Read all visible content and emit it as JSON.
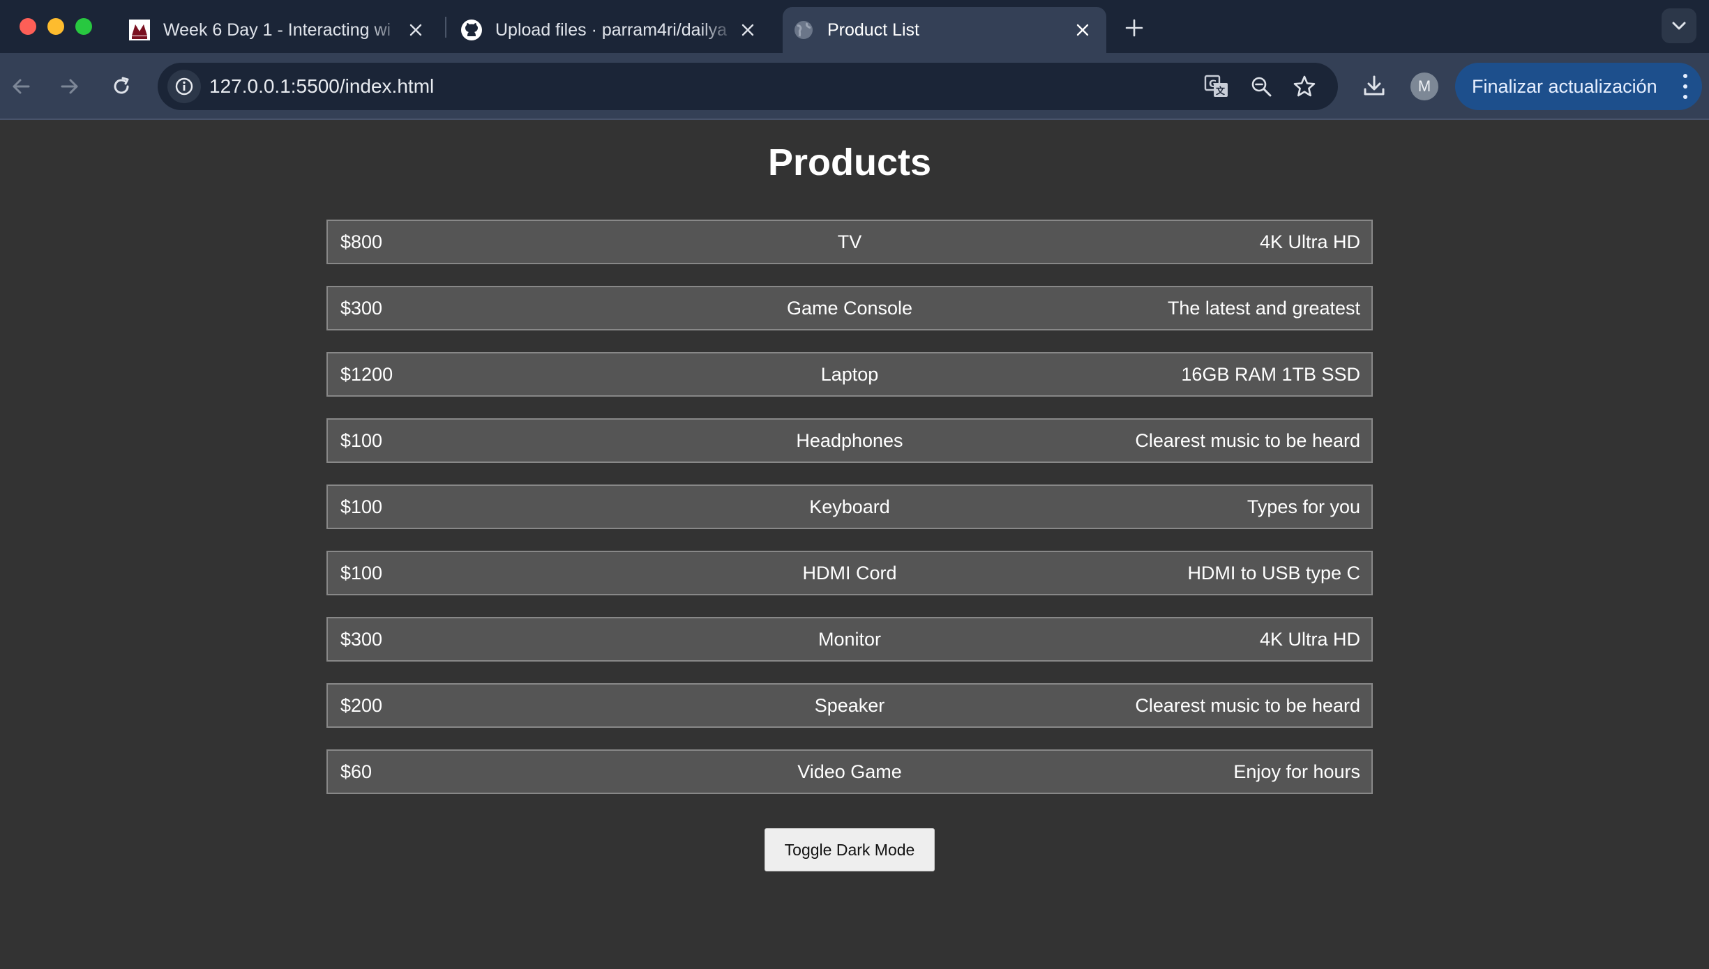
{
  "browser": {
    "tabs": [
      {
        "title": "Week 6 Day 1 - Interacting wi",
        "favicon": "school-logo-icon",
        "active": false
      },
      {
        "title": "Upload files · parram4ri/dailya",
        "favicon": "github-icon",
        "active": false
      },
      {
        "title": "Product List",
        "favicon": "globe-icon",
        "active": true
      }
    ],
    "url": "127.0.0.1:5500/index.html",
    "profile_initial": "M",
    "update_button_label": "Finalizar actualización",
    "colors": {
      "tabstrip": "#1b2537",
      "toolbar": "#344056",
      "update_button": "#1d4f8c"
    }
  },
  "page": {
    "title": "Products",
    "background": "#333333",
    "products": [
      {
        "price": "$800",
        "name": "TV",
        "description": "4K Ultra HD"
      },
      {
        "price": "$300",
        "name": "Game Console",
        "description": "The latest and greatest"
      },
      {
        "price": "$1200",
        "name": "Laptop",
        "description": "16GB RAM 1TB SSD"
      },
      {
        "price": "$100",
        "name": "Headphones",
        "description": "Clearest music to be heard"
      },
      {
        "price": "$100",
        "name": "Keyboard",
        "description": "Types for you"
      },
      {
        "price": "$100",
        "name": "HDMI Cord",
        "description": "HDMI to USB type C"
      },
      {
        "price": "$300",
        "name": "Monitor",
        "description": "4K Ultra HD"
      },
      {
        "price": "$200",
        "name": "Speaker",
        "description": "Clearest music to be heard"
      },
      {
        "price": "$60",
        "name": "Video Game",
        "description": "Enjoy for hours"
      }
    ],
    "toggle_button_label": "Toggle Dark Mode"
  }
}
